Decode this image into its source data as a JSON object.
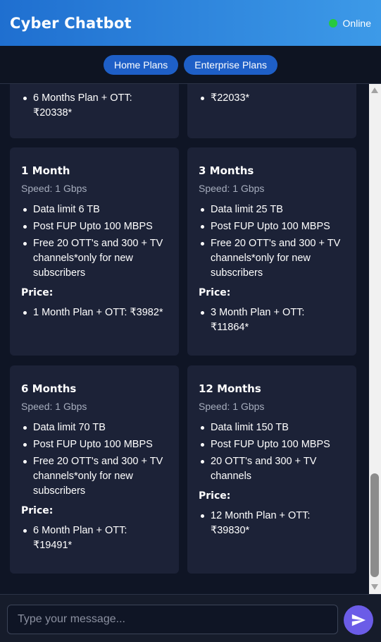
{
  "header": {
    "title": "Cyber Chatbot",
    "status": "Online",
    "status_color": "#27c93f",
    "accent": "#2f86e0"
  },
  "tabs": [
    {
      "label": "Home Plans"
    },
    {
      "label": "Enterprise Plans"
    }
  ],
  "partial_cards": {
    "left": {
      "lines": [
        "6 Months Plan + OTT:",
        "₹20338*"
      ]
    },
    "right": {
      "lines": [
        "₹22033*"
      ]
    }
  },
  "plans": [
    {
      "title": "1 Month",
      "speed": "Speed: 1 Gbps",
      "features": [
        "Data limit 6 TB",
        "Post FUP Upto 100 MBPS",
        "Free 20 OTT's and 300 + TV channels*only for new subscribers"
      ],
      "price_label": "Price:",
      "prices": [
        "1 Month Plan + OTT: ₹3982*"
      ]
    },
    {
      "title": "3 Months",
      "speed": "Speed: 1 Gbps",
      "features": [
        "Data limit 25 TB",
        "Post FUP Upto 100 MBPS",
        "Free 20 OTT's and 300 + TV channels*only for new subscribers"
      ],
      "price_label": "Price:",
      "prices": [
        "3 Month Plan + OTT: ₹11864*"
      ]
    },
    {
      "title": "6 Months",
      "speed": "Speed: 1 Gbps",
      "features": [
        "Data limit 70 TB",
        "Post FUP Upto 100 MBPS",
        "Free 20 OTT's and 300 + TV channels*only for new subscribers"
      ],
      "price_label": "Price:",
      "prices": [
        "6 Month Plan + OTT: ₹19491*"
      ]
    },
    {
      "title": "12 Months",
      "speed": "Speed: 1 Gbps",
      "features": [
        "Data limit 150 TB",
        "Post FUP Upto 100 MBPS",
        "20 OTT's and 300 + TV channels"
      ],
      "price_label": "Price:",
      "prices": [
        "12 Month Plan + OTT: ₹39830*"
      ]
    }
  ],
  "input": {
    "placeholder": "Type your message...",
    "value": ""
  },
  "send": {
    "icon": "send-icon",
    "color": "#6b5ce7"
  }
}
